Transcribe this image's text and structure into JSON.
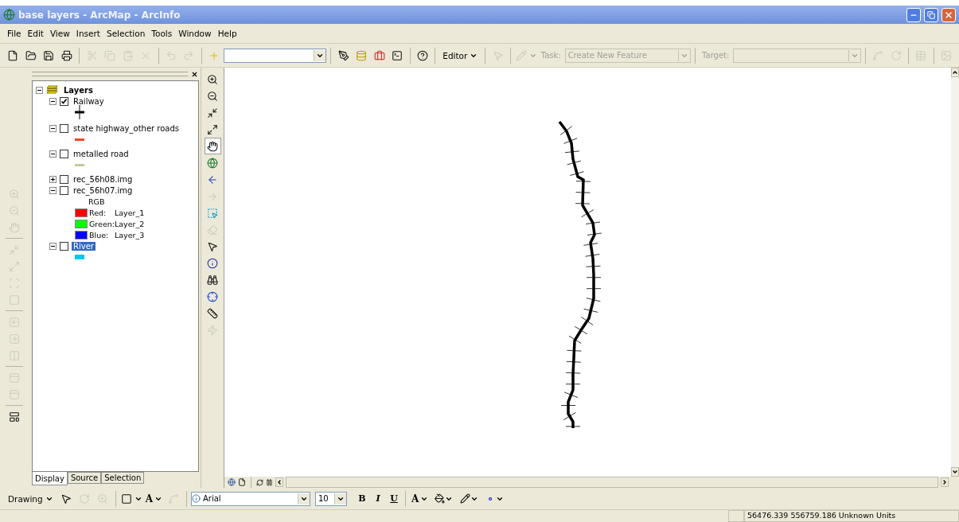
{
  "window": {
    "title": "base layers - ArcMap - ArcInfo"
  },
  "menu": [
    "File",
    "Edit",
    "View",
    "Insert",
    "Selection",
    "Tools",
    "Window",
    "Help"
  ],
  "standard_toolbar": {
    "groups": [
      [
        {
          "disabled": false
        },
        {
          "disabled": false
        },
        {
          "disabled": false
        },
        {
          "disabled": false
        }
      ],
      [
        {
          "disabled": true
        },
        {
          "disabled": true
        },
        {
          "disabled": true
        },
        {
          "disabled": true
        }
      ],
      [
        {
          "disabled": true
        },
        {
          "disabled": true
        }
      ],
      [
        {
          "disabled": false
        }
      ]
    ],
    "tail": [
      [
        {
          "disabled": false
        },
        {
          "disabled": false
        },
        {
          "disabled": false
        },
        {
          "disabled": false
        }
      ],
      [
        {
          "disabled": false
        }
      ]
    ]
  },
  "editor_toolbar": {
    "menu": "Editor",
    "task_label": "Task:",
    "task_value": "Create New Feature",
    "target_label": "Target:",
    "disabled": true
  },
  "layout_toolbar": {
    "groups": [
      [
        {
          "disabled": true
        },
        {
          "disabled": true
        },
        {
          "disabled": true
        }
      ],
      [
        {
          "disabled": true
        },
        {
          "disabled": true
        },
        {
          "disabled": true
        },
        {
          "disabled": true
        }
      ],
      [
        {
          "disabled": true
        },
        {
          "disabled": true
        },
        {
          "disabled": true
        }
      ],
      [
        {
          "disabled": true
        },
        {
          "disabled": true
        }
      ],
      [
        {
          "disabled": false
        }
      ]
    ]
  },
  "tools_toolbar": [
    {
      "disabled": false,
      "selected": false
    },
    {
      "disabled": false,
      "selected": false
    },
    {
      "disabled": false,
      "selected": false
    },
    {
      "disabled": false,
      "selected": false
    },
    {
      "disabled": false,
      "selected": true
    },
    {
      "disabled": false,
      "selected": false
    },
    {
      "disabled": false,
      "selected": false
    },
    {
      "disabled": true,
      "selected": false
    },
    {
      "disabled": false,
      "selected": false
    },
    {
      "disabled": true,
      "selected": false
    },
    {
      "disabled": false,
      "selected": false
    },
    {
      "disabled": false,
      "selected": false
    },
    {
      "disabled": false,
      "selected": false
    },
    {
      "disabled": false,
      "selected": false
    },
    {
      "disabled": false,
      "selected": false
    },
    {
      "disabled": true,
      "selected": false
    }
  ],
  "toc": {
    "root": {
      "label": "Layers",
      "expanded": true,
      "children": [
        {
          "label": "Railway",
          "checked": true,
          "expanded": true,
          "selected": false,
          "legend": [
            {
              "kind": "railway"
            }
          ]
        },
        {
          "label": "state highway_other roads",
          "checked": false,
          "expanded": true,
          "selected": false,
          "legend": [
            {
              "kind": "line",
              "color": "#f04828"
            }
          ]
        },
        {
          "label": "metalled road",
          "checked": false,
          "expanded": true,
          "selected": false,
          "legend": [
            {
              "kind": "line",
              "color": "#c8c8a0"
            }
          ]
        },
        {
          "label": "rec_56h08.img",
          "checked": false,
          "expanded": false,
          "selected": false
        },
        {
          "label": "rec_56h07.img",
          "checked": false,
          "expanded": true,
          "selected": false,
          "legend": [
            {
              "kind": "heading",
              "text": "RGB"
            },
            {
              "kind": "swatch",
              "color": "#ff0000",
              "band": "Red:",
              "value": "Layer_1"
            },
            {
              "kind": "swatch",
              "color": "#00ff00",
              "band": "Green:",
              "value": "Layer_2"
            },
            {
              "kind": "swatch",
              "color": "#0000ff",
              "band": "Blue:",
              "value": "Layer_3"
            }
          ]
        },
        {
          "label": "River",
          "checked": false,
          "expanded": true,
          "selected": true,
          "legend": [
            {
              "kind": "patch",
              "color": "#00c8f0"
            }
          ]
        }
      ]
    }
  },
  "toc_tabs": [
    {
      "label": "Display",
      "selected": true
    },
    {
      "label": "Source",
      "selected": false
    },
    {
      "label": "Selection",
      "selected": false
    }
  ],
  "drawing_toolbar": {
    "menu": "Drawing",
    "tools": [
      {
        "disabled": false
      },
      {
        "disabled": true
      },
      {
        "disabled": true
      },
      {
        "disabled": false
      },
      {
        "disabled": true
      }
    ],
    "text_tool": "A",
    "font": "Arial",
    "size": "10",
    "styles": [
      {
        "text": "B",
        "kind": "bold"
      },
      {
        "text": "I",
        "kind": "italic"
      },
      {
        "text": "U",
        "kind": "underline"
      }
    ],
    "font_color": "A"
  },
  "status_bar": {
    "coordinates": "56476.339  556759.186 Unknown Units"
  }
}
